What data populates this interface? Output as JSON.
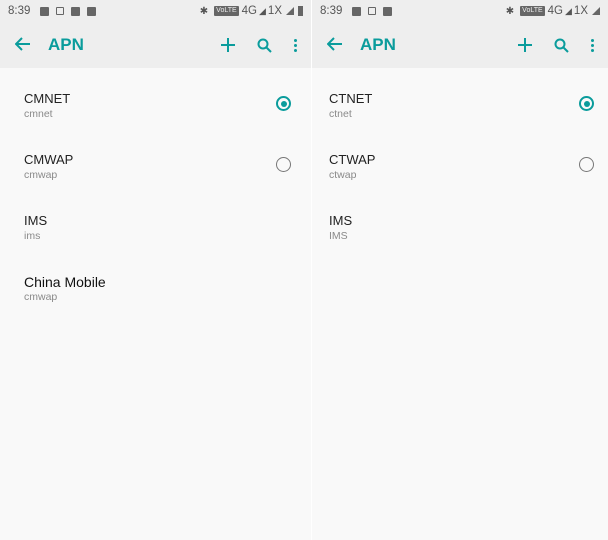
{
  "colors": {
    "accent": "#0a9c9c",
    "bar_bg": "#eeeeee",
    "screen_bg": "#f9f9f9"
  },
  "left_screen": {
    "status": {
      "time": "8:39",
      "network": "4G",
      "network2": "1X",
      "volte": "VoLTE"
    },
    "title": "APN",
    "icons": [
      "back-arrow-icon",
      "plus-icon",
      "search-icon",
      "more-vert-icon"
    ],
    "items": [
      {
        "name": "CMNET",
        "sub": "cmnet",
        "selected": true
      },
      {
        "name": "CMWAP",
        "sub": "cmwap",
        "selected": false
      },
      {
        "name": "IMS",
        "sub": "ims",
        "selected": null
      },
      {
        "name": "China Mobile",
        "sub": "cmwap",
        "selected": null
      }
    ]
  },
  "right_screen": {
    "status": {
      "time": "8:39",
      "network": "4G",
      "network2": "1X",
      "volte": "VoLTE"
    },
    "title": "APN",
    "icons": [
      "back-arrow-icon",
      "plus-icon",
      "search-icon",
      "more-vert-icon"
    ],
    "items": [
      {
        "name": "CTNET",
        "sub": "ctnet",
        "selected": true
      },
      {
        "name": "CTWAP",
        "sub": "ctwap",
        "selected": false
      },
      {
        "name": "IMS",
        "sub": "IMS",
        "selected": null
      }
    ]
  }
}
